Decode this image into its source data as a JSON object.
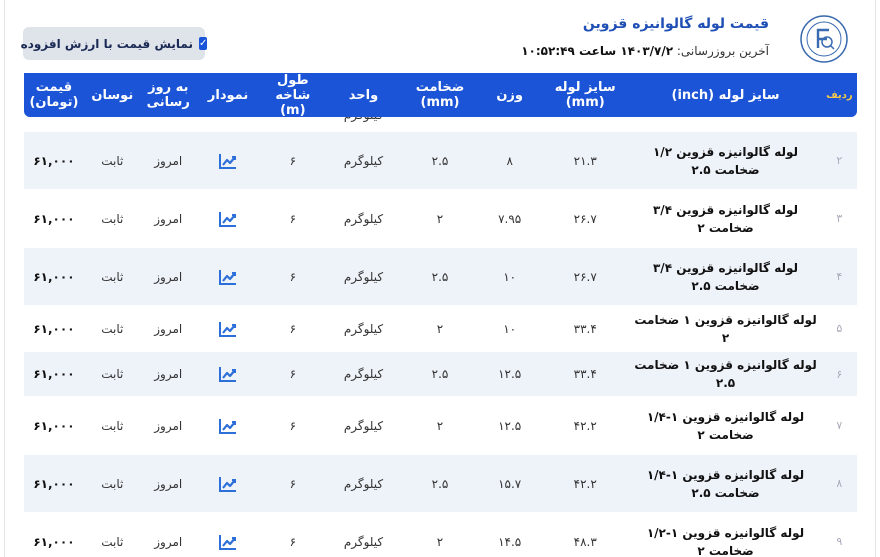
{
  "header": {
    "title": "قیمت لوله گالوانیزه قزوین",
    "updated_label": "آخرین بروزرسانی:",
    "updated_value": "۱۴۰۳/۷/۲ ساعت ۱۰:۵۲:۴۹",
    "vat_label": "نمایش قیمت با ارزش افزوده",
    "vat_checked": true,
    "logo_icon": "qazvin-pipe-logo"
  },
  "table": {
    "headers": {
      "idx": "ردیف",
      "name": "سایز لوله (inch)",
      "size": "سایز لوله (mm)",
      "weight": "وزن",
      "thickness": "ضخامت (mm)",
      "unit": "واحد",
      "length": "طول شاخه (m)",
      "chart": "نمودار",
      "update": "به روز رسانی",
      "fluctuation": "نوسان",
      "price": "قیمت (تومان)"
    },
    "partial_row": {
      "unit": "کیلوگرم"
    },
    "rows": [
      {
        "idx": "۲",
        "name": "لوله گالوانیزه قزوین ۱/۲ ضخامت ۲.۵",
        "size": "۲۱.۳",
        "weight": "۸",
        "thickness": "۲.۵",
        "unit": "کیلوگرم",
        "length": "۶",
        "update": "امروز",
        "fluctuation": "ثابت",
        "price": "۶۱,۰۰۰"
      },
      {
        "idx": "۳",
        "name": "لوله گالوانیزه قزوین ۳/۴ ضخامت ۲",
        "size": "۲۶.۷",
        "weight": "۷.۹۵",
        "thickness": "۲",
        "unit": "کیلوگرم",
        "length": "۶",
        "update": "امروز",
        "fluctuation": "ثابت",
        "price": "۶۱,۰۰۰"
      },
      {
        "idx": "۴",
        "name": "لوله گالوانیزه قزوین ۳/۴ ضخامت ۲.۵",
        "size": "۲۶.۷",
        "weight": "۱۰",
        "thickness": "۲.۵",
        "unit": "کیلوگرم",
        "length": "۶",
        "update": "امروز",
        "fluctuation": "ثابت",
        "price": "۶۱,۰۰۰"
      },
      {
        "idx": "۵",
        "name": "لوله گالوانیزه قزوین ۱ ضخامت ۲",
        "size": "۳۳.۴",
        "weight": "۱۰",
        "thickness": "۲",
        "unit": "کیلوگرم",
        "length": "۶",
        "update": "امروز",
        "fluctuation": "ثابت",
        "price": "۶۱,۰۰۰"
      },
      {
        "idx": "۶",
        "name": "لوله گالوانیزه قزوین ۱ ضخامت ۲.۵",
        "size": "۳۳.۴",
        "weight": "۱۲.۵",
        "thickness": "۲.۵",
        "unit": "کیلوگرم",
        "length": "۶",
        "update": "امروز",
        "fluctuation": "ثابت",
        "price": "۶۱,۰۰۰"
      },
      {
        "idx": "۷",
        "name": "لوله گالوانیزه قزوین ۱-۱/۴ ضخامت ۲",
        "size": "۴۲.۲",
        "weight": "۱۲.۵",
        "thickness": "۲",
        "unit": "کیلوگرم",
        "length": "۶",
        "update": "امروز",
        "fluctuation": "ثابت",
        "price": "۶۱,۰۰۰"
      },
      {
        "idx": "۸",
        "name": "لوله گالوانیزه قزوین ۱-۱/۴ ضخامت ۲.۵",
        "size": "۴۲.۲",
        "weight": "۱۵.۷",
        "thickness": "۲.۵",
        "unit": "کیلوگرم",
        "length": "۶",
        "update": "امروز",
        "fluctuation": "ثابت",
        "price": "۶۱,۰۰۰"
      },
      {
        "idx": "۹",
        "name": "لوله گالوانیزه قزوین ۱-۱/۲ ضخامت ۲",
        "size": "۴۸.۳",
        "weight": "۱۴.۵",
        "thickness": "۲",
        "unit": "کیلوگرم",
        "length": "۶",
        "update": "امروز",
        "fluctuation": "ثابت",
        "price": "۶۱,۰۰۰"
      }
    ],
    "chart_icon": "trend-chart-icon",
    "colors": {
      "header_bg": "#1b54d6",
      "alt_row_bg": "#eef2f9",
      "chart_icon": "#2d6fd9",
      "index_header": "#f2c94c"
    }
  }
}
